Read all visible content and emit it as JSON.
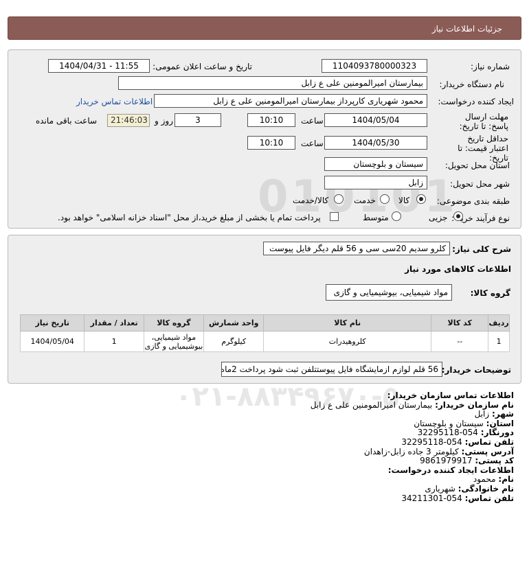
{
  "header": {
    "title": "جزئیات اطلاعات نیاز"
  },
  "details": {
    "need_number_label": "شماره نیاز:",
    "need_number": "1104093780000323",
    "announce_label": "تاریخ و ساعت اعلان عمومی:",
    "announce_value": "1404/04/31 - 11:55",
    "buyer_org_label": "نام دستگاه خریدار:",
    "buyer_org": "بیمارستان امیرالمومنین علی  ع  زابل",
    "creator_label": "ایجاد کننده درخواست:",
    "creator": "محمود شهریاری کارپرداز بیمارستان امیرالمومنین علی  ع  زابل",
    "contact_link": "اطلاعات تماس خریدار",
    "deadline_label": "مهلت ارسال پاسخ: تا تاریخ:",
    "deadline_date": "1404/05/04",
    "time_label": "ساعت",
    "deadline_time": "10:10",
    "days_value": "3",
    "days_label": "روز و",
    "remaining_time": "21:46:03",
    "remaining_label": "ساعت باقی مانده",
    "validity_label": "حداقل تاریخ اعتبار قیمت: تا تاریخ:",
    "validity_date": "1404/05/30",
    "validity_time": "10:10",
    "delivery_province_label": "استان محل تحویل:",
    "delivery_province": "سیستان و بلوچستان",
    "delivery_city_label": "شهر محل تحویل:",
    "delivery_city": "زابل",
    "category_label": "طبقه بندی موضوعی:",
    "category_options": [
      "کالا",
      "خدمت",
      "کالا/خدمت"
    ],
    "process_label": "نوع فرآیند خرید :",
    "process_options": [
      "جزیی",
      "متوسط"
    ],
    "treasury_note": "پرداخت تمام یا بخشی از مبلغ خرید،از محل \"اسناد خزانه اسلامی\" خواهد بود."
  },
  "summary": {
    "label": "شرح کلی نیاز:",
    "value": "کلرو سدیم 20سی سی و 56 قلم دیگر فایل پیوست",
    "goods_info_title": "اطلاعات کالاهای مورد نیاز",
    "group_label": "گروه کالا:",
    "group_value": "مواد شیمیایی، بیوشیمیایی و گازی"
  },
  "table": {
    "headers": [
      "ردیف",
      "کد کالا",
      "نام کالا",
      "واحد شمارش",
      "گروه کالا",
      "تعداد / مقدار",
      "تاریخ نیاز"
    ],
    "rows": [
      [
        "1",
        "--",
        "کلروهیدرات",
        "کیلوگرم",
        "مواد شیمیایی، بیوشیمیایی و گازی",
        "1",
        "1404/05/04"
      ]
    ]
  },
  "buyer_notes": {
    "label": "توضیحات خریدار:",
    "value": "56 قلم لوازم ازمایشگاه فایل پیوستتلفن ثبت شود پرداخت 2ماه"
  },
  "contact": {
    "title": "اطلاعات تماس سازمان خریدار:",
    "rows": [
      {
        "label": "نام سازمان خریدار:",
        "value": "بیمارستان امیرالمومنین علی ع زابل"
      },
      {
        "label": "شهر:",
        "value": "زابل"
      },
      {
        "label": "استان:",
        "value": "سیستان و بلوچستان"
      },
      {
        "label": "دورنگار:",
        "value": "054-32295118"
      },
      {
        "label": "تلفن تماس:",
        "value": "054-32295118"
      },
      {
        "label": "آدرس پستی:",
        "value": "کیلومتر 3 جاده زابل-زاهدان"
      },
      {
        "label": "کد پستی:",
        "value": "9861979917"
      }
    ],
    "creator_title": "اطلاعات ایجاد کننده درخواست:",
    "creator_rows": [
      {
        "label": "نام:",
        "value": "محمود"
      },
      {
        "label": "نام خانوادگی:",
        "value": "شهریاری"
      },
      {
        "label": "تلفن تماس:",
        "value": "054-34211301"
      }
    ]
  },
  "watermark": {
    "brand": "ParsNamadData",
    "phone": "۰۲۱-۸۸۳۴۹۶۷۰-۵",
    "number": "010101"
  },
  "colors": {
    "header": "#8b5c55",
    "panel": "#efeeee",
    "link": "#1a4fa3",
    "timer": "#f4efd2"
  }
}
